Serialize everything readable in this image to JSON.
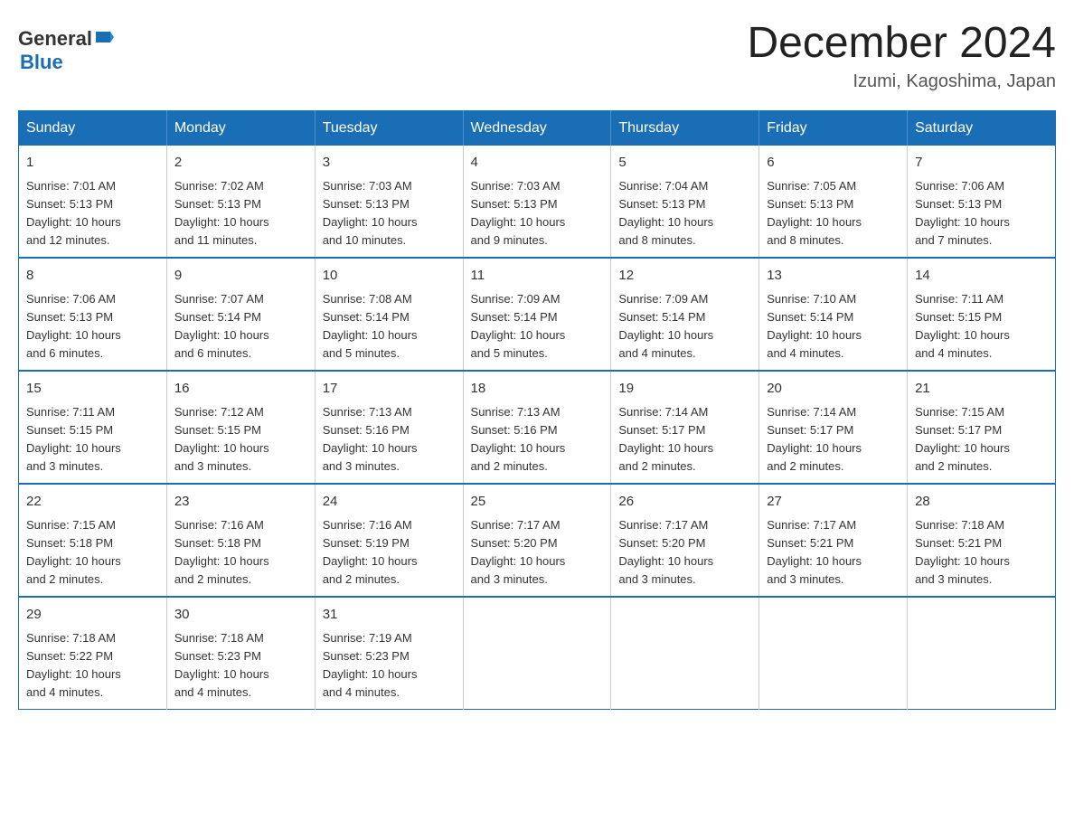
{
  "header": {
    "logo": {
      "general": "General",
      "blue": "Blue",
      "alt": "GeneralBlue logo"
    },
    "title": "December 2024",
    "subtitle": "Izumi, Kagoshima, Japan"
  },
  "calendar": {
    "days_of_week": [
      "Sunday",
      "Monday",
      "Tuesday",
      "Wednesday",
      "Thursday",
      "Friday",
      "Saturday"
    ],
    "weeks": [
      [
        {
          "day": "1",
          "sunrise": "7:01 AM",
          "sunset": "5:13 PM",
          "daylight": "10 hours and 12 minutes."
        },
        {
          "day": "2",
          "sunrise": "7:02 AM",
          "sunset": "5:13 PM",
          "daylight": "10 hours and 11 minutes."
        },
        {
          "day": "3",
          "sunrise": "7:03 AM",
          "sunset": "5:13 PM",
          "daylight": "10 hours and 10 minutes."
        },
        {
          "day": "4",
          "sunrise": "7:03 AM",
          "sunset": "5:13 PM",
          "daylight": "10 hours and 9 minutes."
        },
        {
          "day": "5",
          "sunrise": "7:04 AM",
          "sunset": "5:13 PM",
          "daylight": "10 hours and 8 minutes."
        },
        {
          "day": "6",
          "sunrise": "7:05 AM",
          "sunset": "5:13 PM",
          "daylight": "10 hours and 8 minutes."
        },
        {
          "day": "7",
          "sunrise": "7:06 AM",
          "sunset": "5:13 PM",
          "daylight": "10 hours and 7 minutes."
        }
      ],
      [
        {
          "day": "8",
          "sunrise": "7:06 AM",
          "sunset": "5:13 PM",
          "daylight": "10 hours and 6 minutes."
        },
        {
          "day": "9",
          "sunrise": "7:07 AM",
          "sunset": "5:14 PM",
          "daylight": "10 hours and 6 minutes."
        },
        {
          "day": "10",
          "sunrise": "7:08 AM",
          "sunset": "5:14 PM",
          "daylight": "10 hours and 5 minutes."
        },
        {
          "day": "11",
          "sunrise": "7:09 AM",
          "sunset": "5:14 PM",
          "daylight": "10 hours and 5 minutes."
        },
        {
          "day": "12",
          "sunrise": "7:09 AM",
          "sunset": "5:14 PM",
          "daylight": "10 hours and 4 minutes."
        },
        {
          "day": "13",
          "sunrise": "7:10 AM",
          "sunset": "5:14 PM",
          "daylight": "10 hours and 4 minutes."
        },
        {
          "day": "14",
          "sunrise": "7:11 AM",
          "sunset": "5:15 PM",
          "daylight": "10 hours and 4 minutes."
        }
      ],
      [
        {
          "day": "15",
          "sunrise": "7:11 AM",
          "sunset": "5:15 PM",
          "daylight": "10 hours and 3 minutes."
        },
        {
          "day": "16",
          "sunrise": "7:12 AM",
          "sunset": "5:15 PM",
          "daylight": "10 hours and 3 minutes."
        },
        {
          "day": "17",
          "sunrise": "7:13 AM",
          "sunset": "5:16 PM",
          "daylight": "10 hours and 3 minutes."
        },
        {
          "day": "18",
          "sunrise": "7:13 AM",
          "sunset": "5:16 PM",
          "daylight": "10 hours and 2 minutes."
        },
        {
          "day": "19",
          "sunrise": "7:14 AM",
          "sunset": "5:17 PM",
          "daylight": "10 hours and 2 minutes."
        },
        {
          "day": "20",
          "sunrise": "7:14 AM",
          "sunset": "5:17 PM",
          "daylight": "10 hours and 2 minutes."
        },
        {
          "day": "21",
          "sunrise": "7:15 AM",
          "sunset": "5:17 PM",
          "daylight": "10 hours and 2 minutes."
        }
      ],
      [
        {
          "day": "22",
          "sunrise": "7:15 AM",
          "sunset": "5:18 PM",
          "daylight": "10 hours and 2 minutes."
        },
        {
          "day": "23",
          "sunrise": "7:16 AM",
          "sunset": "5:18 PM",
          "daylight": "10 hours and 2 minutes."
        },
        {
          "day": "24",
          "sunrise": "7:16 AM",
          "sunset": "5:19 PM",
          "daylight": "10 hours and 2 minutes."
        },
        {
          "day": "25",
          "sunrise": "7:17 AM",
          "sunset": "5:20 PM",
          "daylight": "10 hours and 3 minutes."
        },
        {
          "day": "26",
          "sunrise": "7:17 AM",
          "sunset": "5:20 PM",
          "daylight": "10 hours and 3 minutes."
        },
        {
          "day": "27",
          "sunrise": "7:17 AM",
          "sunset": "5:21 PM",
          "daylight": "10 hours and 3 minutes."
        },
        {
          "day": "28",
          "sunrise": "7:18 AM",
          "sunset": "5:21 PM",
          "daylight": "10 hours and 3 minutes."
        }
      ],
      [
        {
          "day": "29",
          "sunrise": "7:18 AM",
          "sunset": "5:22 PM",
          "daylight": "10 hours and 4 minutes."
        },
        {
          "day": "30",
          "sunrise": "7:18 AM",
          "sunset": "5:23 PM",
          "daylight": "10 hours and 4 minutes."
        },
        {
          "day": "31",
          "sunrise": "7:19 AM",
          "sunset": "5:23 PM",
          "daylight": "10 hours and 4 minutes."
        },
        null,
        null,
        null,
        null
      ]
    ],
    "labels": {
      "sunrise": "Sunrise:",
      "sunset": "Sunset:",
      "daylight": "Daylight:"
    }
  }
}
